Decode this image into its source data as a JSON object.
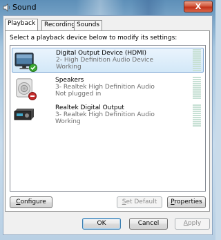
{
  "window": {
    "title": "Sound",
    "close_symbol": "X"
  },
  "tabs": [
    {
      "label": "Playback",
      "active": true
    },
    {
      "label": "Recording",
      "active": false
    },
    {
      "label": "Sounds",
      "active": false
    }
  ],
  "instruction": "Select a playback device below to modify its settings:",
  "devices": [
    {
      "name": "Digital Output Device (HDMI)",
      "driver": "2- High Definition Audio Device",
      "status": "Working",
      "icon": "monitor-icon",
      "badge": "default-check-badge",
      "selected": true
    },
    {
      "name": "Speakers",
      "driver": "3- Realtek High Definition Audio",
      "status": "Not plugged in",
      "icon": "speaker-icon",
      "badge": "unplugged-badge",
      "selected": false
    },
    {
      "name": "Realtek Digital Output",
      "driver": "3- Realtek High Definition Audio",
      "status": "Working",
      "icon": "receiver-icon",
      "badge": "",
      "selected": false
    }
  ],
  "buttons": {
    "configure_accel": "C",
    "configure_rest": "onfigure",
    "set_default_accel": "S",
    "set_default_rest": "et Default",
    "properties_accel": "P",
    "properties_rest": "roperties",
    "ok": "OK",
    "cancel": "Cancel",
    "apply_accel": "A",
    "apply_rest": "pply"
  },
  "colors": {
    "selection": "#d3e8f8",
    "meter": "#c7e0d4",
    "badge_green": "#3aa832",
    "badge_red": "#c62d2d"
  }
}
